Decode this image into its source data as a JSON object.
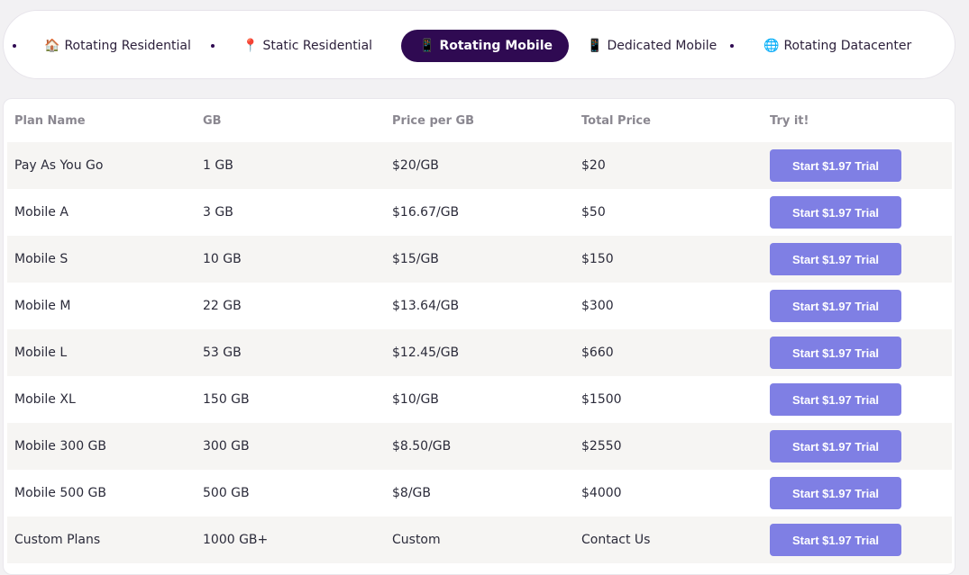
{
  "tabs": [
    {
      "label": "Rotating Residential",
      "icon": "house-icon",
      "glyph": "🏠",
      "active": false
    },
    {
      "label": "Static Residential",
      "icon": "pin-icon",
      "glyph": "📍",
      "active": false
    },
    {
      "label": "Rotating Mobile",
      "icon": "mobile-icon",
      "glyph": "📱",
      "active": true
    },
    {
      "label": "Dedicated Mobile",
      "icon": "mobile-icon",
      "glyph": "📱",
      "active": false
    },
    {
      "label": "Rotating Datacenter",
      "icon": "globe-icon",
      "glyph": "🌐",
      "active": false
    }
  ],
  "colors": {
    "active_tab_bg": "#2f0a52",
    "button_bg": "#7f7fe4",
    "row_shade": "#f6f5f3",
    "header_text": "#8a8790"
  },
  "table": {
    "headers": [
      "Plan Name",
      "GB",
      "Price per GB",
      "Total Price",
      "Try it!"
    ],
    "rows": [
      {
        "plan": "Pay As You Go",
        "gb": "1 GB",
        "price_per_gb": "$20/GB",
        "total": "$20",
        "button": "Start $1.97 Trial"
      },
      {
        "plan": "Mobile A",
        "gb": "3 GB",
        "price_per_gb": "$16.67/GB",
        "total": "$50",
        "button": "Start $1.97 Trial"
      },
      {
        "plan": "Mobile S",
        "gb": "10 GB",
        "price_per_gb": "$15/GB",
        "total": "$150",
        "button": "Start $1.97 Trial"
      },
      {
        "plan": "Mobile M",
        "gb": "22 GB",
        "price_per_gb": "$13.64/GB",
        "total": "$300",
        "button": "Start $1.97 Trial"
      },
      {
        "plan": "Mobile L",
        "gb": "53 GB",
        "price_per_gb": "$12.45/GB",
        "total": "$660",
        "button": "Start $1.97 Trial"
      },
      {
        "plan": "Mobile XL",
        "gb": "150 GB",
        "price_per_gb": "$10/GB",
        "total": "$1500",
        "button": "Start $1.97 Trial"
      },
      {
        "plan": "Mobile 300 GB",
        "gb": "300 GB",
        "price_per_gb": "$8.50/GB",
        "total": "$2550",
        "button": "Start $1.97 Trial"
      },
      {
        "plan": "Mobile 500 GB",
        "gb": "500 GB",
        "price_per_gb": "$8/GB",
        "total": "$4000",
        "button": "Start $1.97 Trial"
      },
      {
        "plan": "Custom Plans",
        "gb": "1000 GB+",
        "price_per_gb": "Custom",
        "total": "Contact Us",
        "button": "Start $1.97 Trial"
      }
    ]
  }
}
